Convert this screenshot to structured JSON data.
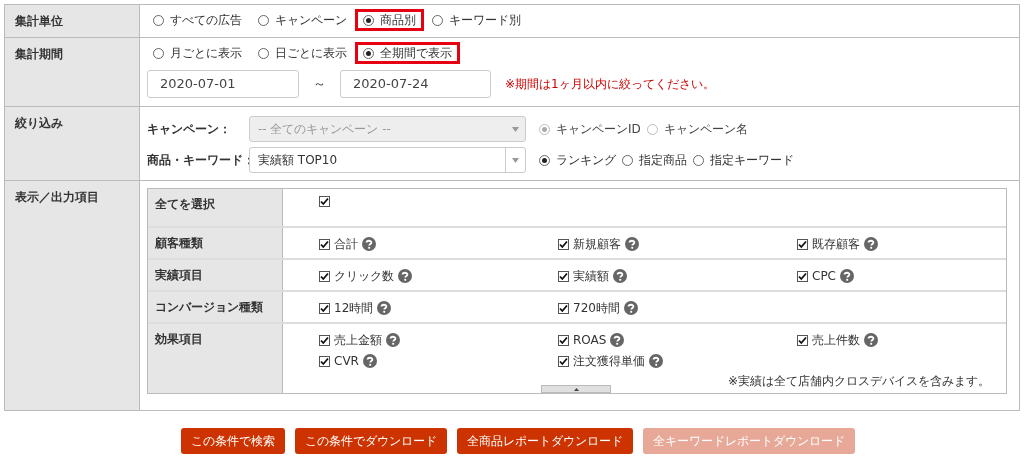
{
  "sections": [
    {
      "kind": "radios",
      "label": "集計単位",
      "options": [
        {
          "label": "すべての広告",
          "selected": false,
          "highlighted": false
        },
        {
          "label": "キャンペーン",
          "selected": false,
          "highlighted": false
        },
        {
          "label": "商品別",
          "selected": true,
          "highlighted": true
        },
        {
          "label": "キーワード別",
          "selected": false,
          "highlighted": false
        }
      ]
    },
    {
      "kind": "period",
      "label": "集計期間",
      "options": [
        {
          "label": "月ごとに表示",
          "selected": false,
          "highlighted": false
        },
        {
          "label": "日ごとに表示",
          "selected": false,
          "highlighted": false
        },
        {
          "label": "全期間で表示",
          "selected": true,
          "highlighted": true
        }
      ],
      "date_from": "2020-07-01",
      "separator": "～",
      "date_to": "2020-07-24",
      "note": "※期間は1ヶ月以内に絞ってください。"
    },
    {
      "kind": "filters",
      "label": "絞り込み",
      "filters": [
        {
          "label": "キャンペーン：",
          "value": "-- 全てのキャンペーン --",
          "disabled": true,
          "options": [
            {
              "label": "キャンペーンID",
              "selected": true
            },
            {
              "label": "キャンペーン名",
              "selected": false
            }
          ]
        },
        {
          "label": "商品・キーワード：",
          "value": "実績額 TOP10",
          "disabled": false,
          "options": [
            {
              "label": "ランキング",
              "selected": true
            },
            {
              "label": "指定商品",
              "selected": false
            },
            {
              "label": "指定キーワード",
              "selected": false
            }
          ]
        }
      ]
    },
    {
      "kind": "outputs",
      "label": "表示／出力項目",
      "groups": [
        {
          "label": "全てを選択",
          "items": [
            {
              "checked": true
            }
          ]
        },
        {
          "label": "顧客種類",
          "items": [
            {
              "label": "合計",
              "checked": true,
              "help": true
            },
            {
              "label": "新規顧客",
              "checked": true,
              "help": true
            },
            {
              "label": "既存顧客",
              "checked": true,
              "help": true
            }
          ]
        },
        {
          "label": "実績項目",
          "items": [
            {
              "label": "クリック数",
              "checked": true,
              "help": true
            },
            {
              "label": "実績額",
              "checked": true,
              "help": true
            },
            {
              "label": "CPC",
              "checked": true,
              "help": true
            }
          ]
        },
        {
          "label": "コンバージョン種類",
          "items": [
            {
              "label": "12時間",
              "checked": true,
              "help": true
            },
            {
              "label": "720時間",
              "checked": true,
              "help": true
            }
          ]
        },
        {
          "label": "効果項目",
          "items": [
            {
              "label": "売上金額",
              "checked": true,
              "help": true
            },
            {
              "label": "ROAS",
              "checked": true,
              "help": true
            },
            {
              "label": "売上件数",
              "checked": true,
              "help": true
            },
            {
              "label": "CVR",
              "checked": true,
              "help": true
            },
            {
              "label": "注文獲得単価",
              "checked": true,
              "help": true
            }
          ],
          "note": "※実績は全て店舗内クロスデバイスを含みます。"
        }
      ]
    }
  ],
  "buttons": [
    {
      "label": "この条件で検索",
      "disabled": false
    },
    {
      "label": "この条件でダウンロード",
      "disabled": false
    },
    {
      "label": "全商品レポートダウンロード",
      "disabled": false
    },
    {
      "label": "全キーワードレポートダウンロード",
      "disabled": true
    }
  ]
}
